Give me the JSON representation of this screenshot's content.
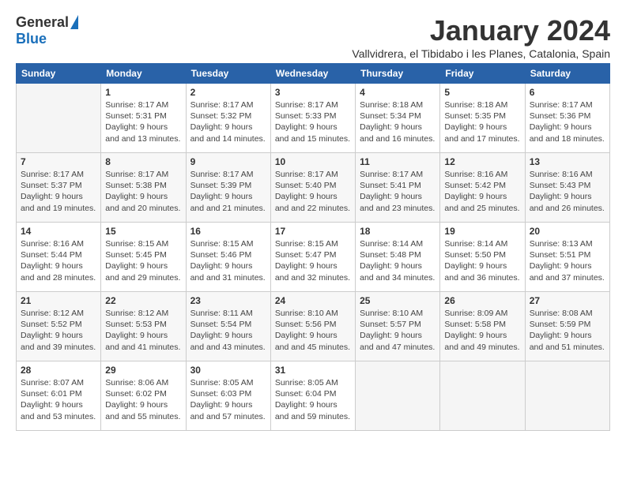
{
  "header": {
    "logo_general": "General",
    "logo_blue": "Blue",
    "month_title": "January 2024",
    "subtitle": "Vallvidrera, el Tibidabo i les Planes, Catalonia, Spain"
  },
  "weekdays": [
    "Sunday",
    "Monday",
    "Tuesday",
    "Wednesday",
    "Thursday",
    "Friday",
    "Saturday"
  ],
  "weeks": [
    [
      {
        "date": "",
        "sunrise": "",
        "sunset": "",
        "daylight": ""
      },
      {
        "date": "1",
        "sunrise": "Sunrise: 8:17 AM",
        "sunset": "Sunset: 5:31 PM",
        "daylight": "Daylight: 9 hours and 13 minutes."
      },
      {
        "date": "2",
        "sunrise": "Sunrise: 8:17 AM",
        "sunset": "Sunset: 5:32 PM",
        "daylight": "Daylight: 9 hours and 14 minutes."
      },
      {
        "date": "3",
        "sunrise": "Sunrise: 8:17 AM",
        "sunset": "Sunset: 5:33 PM",
        "daylight": "Daylight: 9 hours and 15 minutes."
      },
      {
        "date": "4",
        "sunrise": "Sunrise: 8:18 AM",
        "sunset": "Sunset: 5:34 PM",
        "daylight": "Daylight: 9 hours and 16 minutes."
      },
      {
        "date": "5",
        "sunrise": "Sunrise: 8:18 AM",
        "sunset": "Sunset: 5:35 PM",
        "daylight": "Daylight: 9 hours and 17 minutes."
      },
      {
        "date": "6",
        "sunrise": "Sunrise: 8:17 AM",
        "sunset": "Sunset: 5:36 PM",
        "daylight": "Daylight: 9 hours and 18 minutes."
      }
    ],
    [
      {
        "date": "7",
        "sunrise": "Sunrise: 8:17 AM",
        "sunset": "Sunset: 5:37 PM",
        "daylight": "Daylight: 9 hours and 19 minutes."
      },
      {
        "date": "8",
        "sunrise": "Sunrise: 8:17 AM",
        "sunset": "Sunset: 5:38 PM",
        "daylight": "Daylight: 9 hours and 20 minutes."
      },
      {
        "date": "9",
        "sunrise": "Sunrise: 8:17 AM",
        "sunset": "Sunset: 5:39 PM",
        "daylight": "Daylight: 9 hours and 21 minutes."
      },
      {
        "date": "10",
        "sunrise": "Sunrise: 8:17 AM",
        "sunset": "Sunset: 5:40 PM",
        "daylight": "Daylight: 9 hours and 22 minutes."
      },
      {
        "date": "11",
        "sunrise": "Sunrise: 8:17 AM",
        "sunset": "Sunset: 5:41 PM",
        "daylight": "Daylight: 9 hours and 23 minutes."
      },
      {
        "date": "12",
        "sunrise": "Sunrise: 8:16 AM",
        "sunset": "Sunset: 5:42 PM",
        "daylight": "Daylight: 9 hours and 25 minutes."
      },
      {
        "date": "13",
        "sunrise": "Sunrise: 8:16 AM",
        "sunset": "Sunset: 5:43 PM",
        "daylight": "Daylight: 9 hours and 26 minutes."
      }
    ],
    [
      {
        "date": "14",
        "sunrise": "Sunrise: 8:16 AM",
        "sunset": "Sunset: 5:44 PM",
        "daylight": "Daylight: 9 hours and 28 minutes."
      },
      {
        "date": "15",
        "sunrise": "Sunrise: 8:15 AM",
        "sunset": "Sunset: 5:45 PM",
        "daylight": "Daylight: 9 hours and 29 minutes."
      },
      {
        "date": "16",
        "sunrise": "Sunrise: 8:15 AM",
        "sunset": "Sunset: 5:46 PM",
        "daylight": "Daylight: 9 hours and 31 minutes."
      },
      {
        "date": "17",
        "sunrise": "Sunrise: 8:15 AM",
        "sunset": "Sunset: 5:47 PM",
        "daylight": "Daylight: 9 hours and 32 minutes."
      },
      {
        "date": "18",
        "sunrise": "Sunrise: 8:14 AM",
        "sunset": "Sunset: 5:48 PM",
        "daylight": "Daylight: 9 hours and 34 minutes."
      },
      {
        "date": "19",
        "sunrise": "Sunrise: 8:14 AM",
        "sunset": "Sunset: 5:50 PM",
        "daylight": "Daylight: 9 hours and 36 minutes."
      },
      {
        "date": "20",
        "sunrise": "Sunrise: 8:13 AM",
        "sunset": "Sunset: 5:51 PM",
        "daylight": "Daylight: 9 hours and 37 minutes."
      }
    ],
    [
      {
        "date": "21",
        "sunrise": "Sunrise: 8:12 AM",
        "sunset": "Sunset: 5:52 PM",
        "daylight": "Daylight: 9 hours and 39 minutes."
      },
      {
        "date": "22",
        "sunrise": "Sunrise: 8:12 AM",
        "sunset": "Sunset: 5:53 PM",
        "daylight": "Daylight: 9 hours and 41 minutes."
      },
      {
        "date": "23",
        "sunrise": "Sunrise: 8:11 AM",
        "sunset": "Sunset: 5:54 PM",
        "daylight": "Daylight: 9 hours and 43 minutes."
      },
      {
        "date": "24",
        "sunrise": "Sunrise: 8:10 AM",
        "sunset": "Sunset: 5:56 PM",
        "daylight": "Daylight: 9 hours and 45 minutes."
      },
      {
        "date": "25",
        "sunrise": "Sunrise: 8:10 AM",
        "sunset": "Sunset: 5:57 PM",
        "daylight": "Daylight: 9 hours and 47 minutes."
      },
      {
        "date": "26",
        "sunrise": "Sunrise: 8:09 AM",
        "sunset": "Sunset: 5:58 PM",
        "daylight": "Daylight: 9 hours and 49 minutes."
      },
      {
        "date": "27",
        "sunrise": "Sunrise: 8:08 AM",
        "sunset": "Sunset: 5:59 PM",
        "daylight": "Daylight: 9 hours and 51 minutes."
      }
    ],
    [
      {
        "date": "28",
        "sunrise": "Sunrise: 8:07 AM",
        "sunset": "Sunset: 6:01 PM",
        "daylight": "Daylight: 9 hours and 53 minutes."
      },
      {
        "date": "29",
        "sunrise": "Sunrise: 8:06 AM",
        "sunset": "Sunset: 6:02 PM",
        "daylight": "Daylight: 9 hours and 55 minutes."
      },
      {
        "date": "30",
        "sunrise": "Sunrise: 8:05 AM",
        "sunset": "Sunset: 6:03 PM",
        "daylight": "Daylight: 9 hours and 57 minutes."
      },
      {
        "date": "31",
        "sunrise": "Sunrise: 8:05 AM",
        "sunset": "Sunset: 6:04 PM",
        "daylight": "Daylight: 9 hours and 59 minutes."
      },
      {
        "date": "",
        "sunrise": "",
        "sunset": "",
        "daylight": ""
      },
      {
        "date": "",
        "sunrise": "",
        "sunset": "",
        "daylight": ""
      },
      {
        "date": "",
        "sunrise": "",
        "sunset": "",
        "daylight": ""
      }
    ]
  ]
}
